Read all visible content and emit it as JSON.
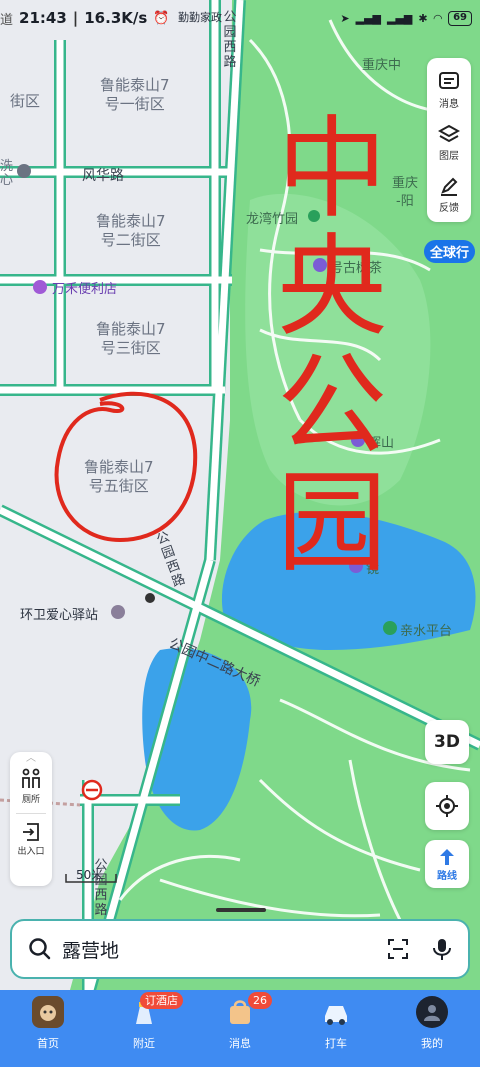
{
  "status_bar": {
    "time": "21:43",
    "net_speed": "16.3K/s",
    "network": "4G",
    "battery": "69"
  },
  "map": {
    "blocks": {
      "block_1": "鲁能泰山7\n号一街区",
      "block_2": "鲁能泰山7\n号二街区",
      "block_3": "鲁能泰山7\n号三街区",
      "block_5": "鲁能泰山7\n号五街区"
    },
    "roads": {
      "fenghua": "风华路",
      "gongyuan_west_top": "公园西路",
      "gongyuan_west_mid": "公园西路",
      "gongyuan_west_bottom": "公园西路",
      "bridge": "公园中二路大桥"
    },
    "pois": {
      "qinqin": "勤勤家政",
      "xiaoqu_left_top": "道",
      "xiaoqu_left_mid1": "街区",
      "xiaoqu_left_wash": "洗\n心",
      "wanhe": "万禾便利店",
      "longwan": "龙湾竹园",
      "gushu": "号古树茶",
      "huishan": "辉山",
      "jingshan": "镜",
      "qinshui": "亲水平台",
      "huanwei": "环卫爱心驿站",
      "chongqing1": "重庆中",
      "chongqing2": "重庆",
      "yangguang": "-阳"
    },
    "badge_quanqiuxing": "全球行",
    "scale": "50米",
    "handwriting": "中央公园"
  },
  "tools": [
    {
      "label": "消息",
      "icon": "message-icon"
    },
    {
      "label": "图层",
      "icon": "layers-icon"
    },
    {
      "label": "反馈",
      "icon": "feedback-icon"
    }
  ],
  "fab_3d": "3D",
  "fab_route": "路线",
  "facility": [
    {
      "label": "厕所",
      "icon": "toilet-icon"
    },
    {
      "label": "出入口",
      "icon": "entrance-icon"
    }
  ],
  "search": {
    "value": "露营地"
  },
  "nav": [
    {
      "label": "首页",
      "icon": "home-avatar-icon"
    },
    {
      "label": "附近",
      "icon": "nearby-icon",
      "badge": "订酒店"
    },
    {
      "label": "消息",
      "icon": "message-bag-icon",
      "badge": "26"
    },
    {
      "label": "打车",
      "icon": "taxi-icon"
    },
    {
      "label": "我的",
      "icon": "profile-icon"
    }
  ],
  "colors": {
    "park_green": "#7fd98a",
    "road_border": "#37b68b",
    "water": "#3ba2ea",
    "nav_blue": "#3f8bf2",
    "ink_red": "#e0291d"
  }
}
